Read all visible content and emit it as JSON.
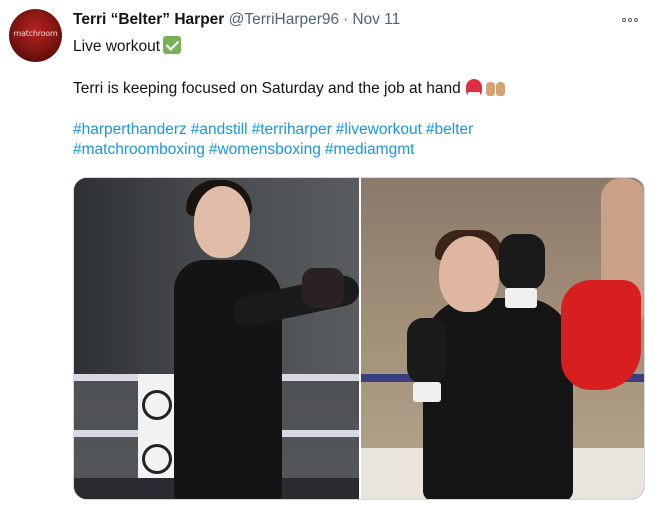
{
  "tweet": {
    "avatar_text": "matchroom",
    "display_name": "Terri “Belter” Harper",
    "handle": "@TerriHarper96",
    "separator": "·",
    "date": "Nov 11",
    "text_line1": "Live workout",
    "text_line1_emoji": "check-mark-icon",
    "text_line2": "Terri is keeping focused on Saturday and the job at hand",
    "text_line2_emojis": [
      "boxing-glove-icon",
      "raising-hands-icon"
    ],
    "hashtags_line1": [
      "#harperthanderz",
      "#andstill",
      "#terriharper",
      "#liveworkout",
      "#belter"
    ],
    "hashtags_line2": [
      "#matchroomboxing",
      "#womensboxing",
      "#mediamgmt"
    ],
    "images": [
      {
        "name": "boxer-wrapping-hands-photo"
      },
      {
        "name": "boxer-guard-pad-work-photo"
      }
    ]
  },
  "colors": {
    "link": "#1b95e0",
    "secondary_text": "#536471",
    "primary_text": "#0f1419"
  }
}
